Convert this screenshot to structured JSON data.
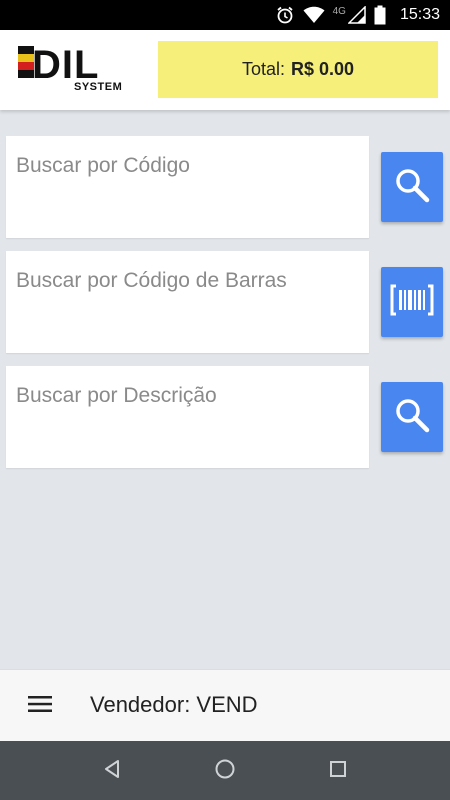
{
  "status_bar": {
    "network": "4G",
    "time": "15:33",
    "icons": [
      "alarm-icon",
      "wifi-icon",
      "signal-icon",
      "battery-icon"
    ]
  },
  "header": {
    "logo_text": "EDIL",
    "logo_subtext": "SYSTEM",
    "total_label": "Total:",
    "total_value": "R$ 0.00",
    "total_bg": "#f6f07a"
  },
  "search": {
    "code_placeholder": "Buscar por Código",
    "barcode_placeholder": "Buscar por Código de Barras",
    "description_placeholder": "Buscar por Descrição",
    "button_color": "#4a86f0"
  },
  "bottom_bar": {
    "vendor_label": "Vendedor: VEND"
  },
  "nav": {
    "icons": [
      "back-icon",
      "home-icon",
      "recents-icon"
    ]
  }
}
